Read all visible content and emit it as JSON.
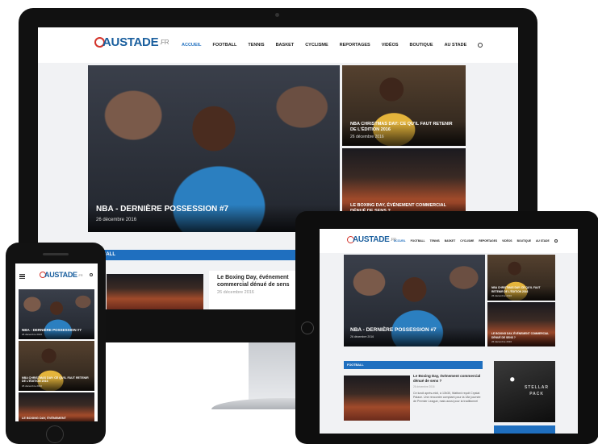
{
  "site": {
    "logo": {
      "brand": "AUSTADE",
      "tld": ".FR"
    },
    "nav": [
      "ACCUEIL",
      "FOOTBALL",
      "TENNIS",
      "BASKET",
      "CYCLISME",
      "REPORTAGES",
      "VIDÉOS",
      "BOUTIQUE",
      "AU STADE"
    ],
    "tablet_nav": [
      "ACCUEIL",
      "FOOTBALL",
      "TENNIS",
      "BASKET",
      "CYCLISME",
      "REPORTAGES",
      "VIDÉOS",
      "BOUTIQUE",
      "AU STADE"
    ]
  },
  "articles": {
    "hero": {
      "title": "NBA - DERNIÈRE POSSESSION #7",
      "date": "26 décembre 2016"
    },
    "christmas": {
      "title": "NBA CHRISTMAS DAY: CE QU'IL FAUT RETENIR DE L'ÉDITION 2016",
      "date": "26 décembre 2016"
    },
    "boxing_tile": {
      "title": "LE BOXING DAY, ÉVÉNEMENT COMMERCIAL DÉNUÉ DE SENS ?",
      "date": "26 décembre 2016"
    },
    "boxing_card": {
      "title": "Le Boxing Day, événement commercial dénué de sens ?",
      "date": "26 décembre 2016",
      "excerpt": "Ce lundi après-midi, à 13h30, Watford reçoit Crystal Palace. Une rencontre comptant pour la 18e journée de Premier League, mais aussi pour la traditionnel"
    },
    "phone_boxing_title": "LE BOXING DAY, ÉVÉNEMENT"
  },
  "sections": {
    "football": "FOOTBALL",
    "football_cut": "BALL"
  },
  "sidebar_ad": {
    "line1": "STELLAR",
    "line2": "PACK"
  },
  "colors": {
    "accent": "#1f6fbf",
    "logo_ring": "#d3342b",
    "device_bezel": "#111111"
  }
}
